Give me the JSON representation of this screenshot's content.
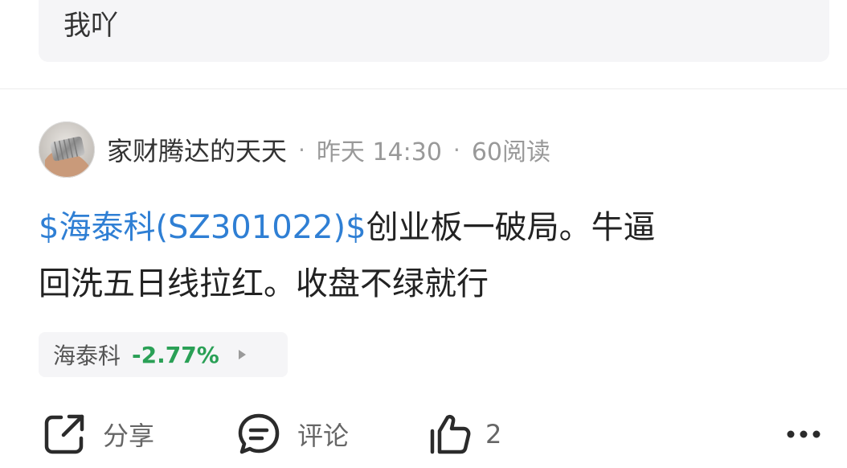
{
  "quoted_reply": {
    "text": "我吖"
  },
  "post": {
    "author": "家财腾达的天天",
    "separator": "·",
    "time": "昨天 14:30",
    "reads": "60阅读",
    "body": {
      "stock_link": "$海泰科(SZ301022)$",
      "text_line1": "创业板一破局。牛逼",
      "text_line2": "回洗五日线拉红。收盘不绿就行"
    },
    "stock_chip": {
      "name": "海泰科",
      "change": "-2.77%",
      "change_color": "#2aa056"
    }
  },
  "actions": {
    "share_label": "分享",
    "comment_label": "评论",
    "like_count": "2",
    "more_icon": "more-dots-icon"
  },
  "colors": {
    "link": "#2f7fd4",
    "chip_background": "#f5f5f7",
    "muted_text": "#999999"
  }
}
